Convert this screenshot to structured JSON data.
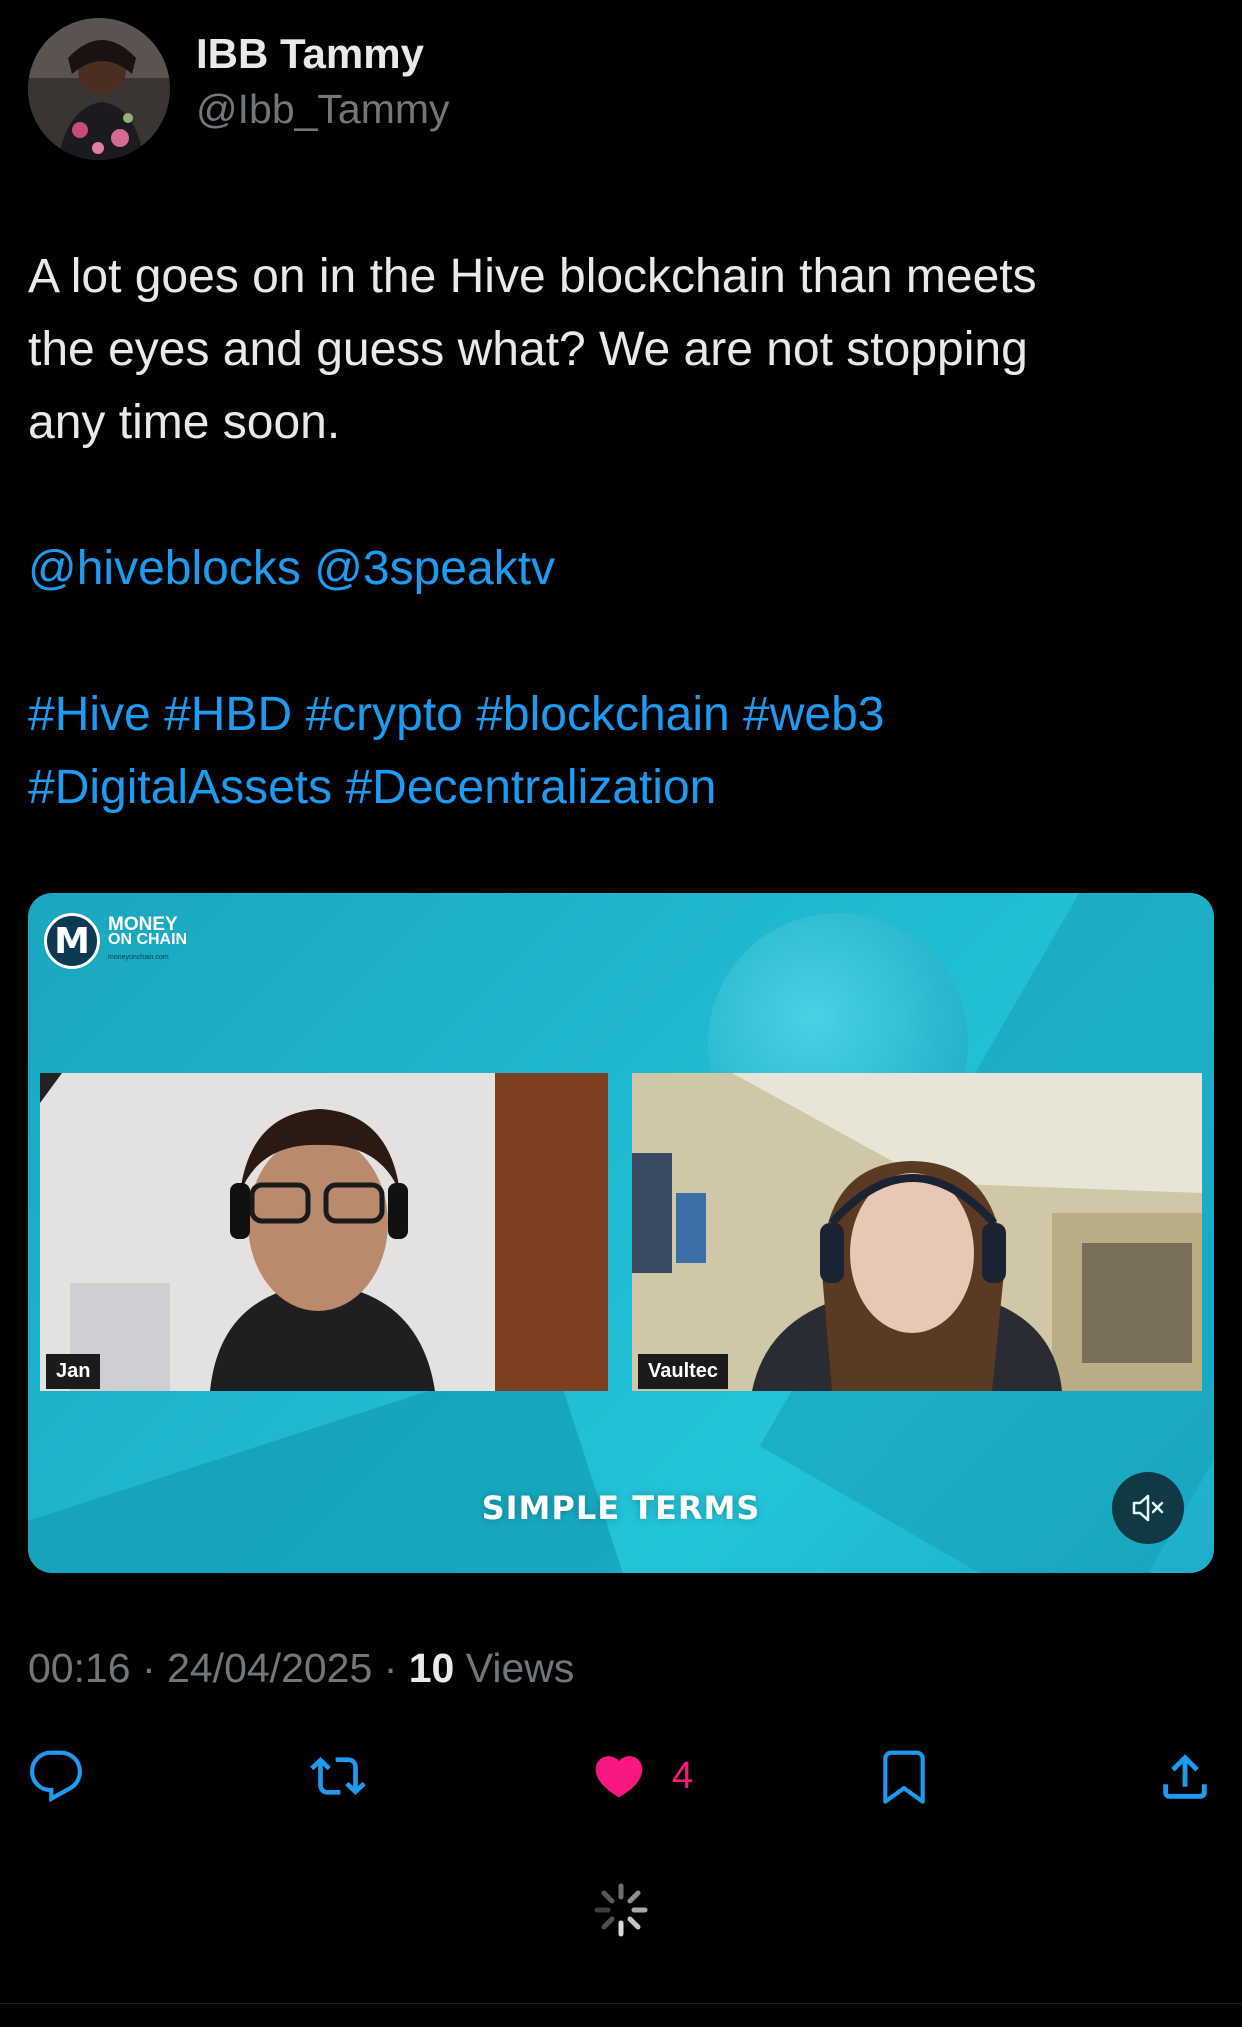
{
  "author": {
    "display_name": "IBB Tammy",
    "handle": "@Ibb_Tammy"
  },
  "tweet": {
    "line1": "A lot goes on in the Hive blockchain than meets",
    "line2": "the eyes and guess what? We are not stopping",
    "line3": "any time soon.",
    "mentions": [
      "@hiveblocks",
      "@3speaktv"
    ],
    "hashtags_line1": [
      "#Hive",
      "#HBD",
      "#crypto",
      "#blockchain",
      "#web3"
    ],
    "hashtags_line2": [
      "#DigitalAssets",
      "#Decentralization"
    ]
  },
  "media": {
    "logo_letter": "M",
    "logo_line1": "MONEY",
    "logo_line2": "ON CHAIN",
    "logo_line3": "moneyonchain.com",
    "left_name": "Jan",
    "right_name": "Vaultec",
    "caption": "SIMPLE TERMS",
    "mute_icon": "volume-muted-icon"
  },
  "meta": {
    "time": "00:16",
    "date": "24/04/2025",
    "views_count": "10",
    "views_label": "Views",
    "separator": "·"
  },
  "actions": {
    "reply_icon": "reply-icon",
    "retweet_icon": "retweet-icon",
    "like_icon": "heart-filled-icon",
    "like_count": "4",
    "bookmark_icon": "bookmark-icon",
    "share_icon": "share-icon"
  },
  "colors": {
    "background": "#000000",
    "text": "#e7e9ea",
    "muted": "#71767b",
    "link": "#1d9bf0",
    "like": "#f91880",
    "media_teal": "#1fb7cf"
  }
}
